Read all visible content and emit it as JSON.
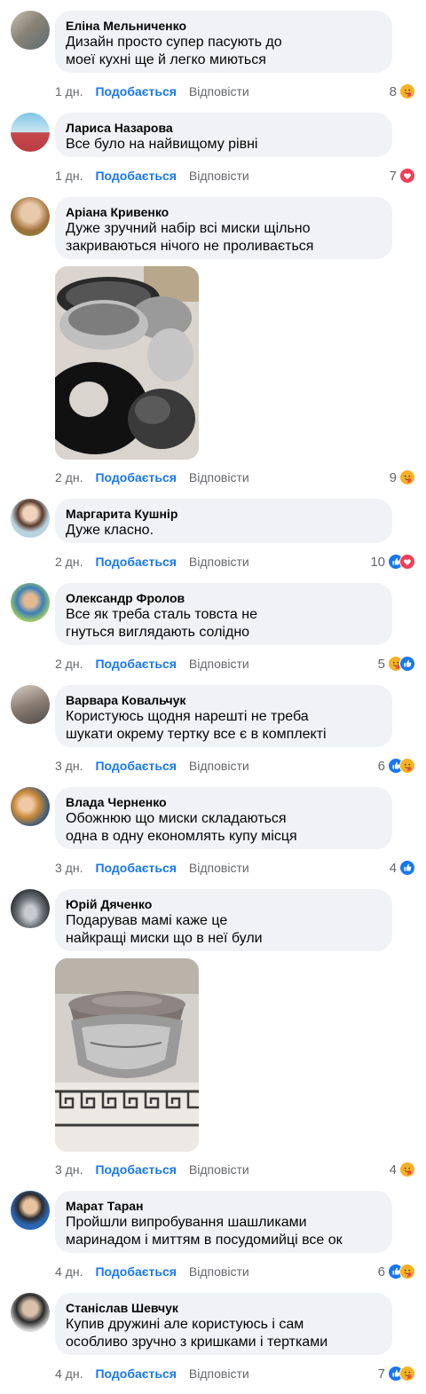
{
  "labels": {
    "like": "Подобається",
    "reply": "Відповісти"
  },
  "comments": [
    {
      "name": "Еліна Мельниченко",
      "lines": [
        "Дизайн просто супер пасують до",
        "моеї кухні ще й легко миються"
      ],
      "time": "1 дн.",
      "count": "8",
      "reactions": [
        "care-icon"
      ]
    },
    {
      "name": "Лариса Назарова",
      "lines": [
        "Все було на найвищому рівні"
      ],
      "time": "1 дн.",
      "count": "7",
      "reactions": [
        "love-icon"
      ]
    },
    {
      "name": "Аріана Кривенко",
      "lines": [
        "Дуже зручний набір всі миски щільно",
        "закриваються нічого не проливається"
      ],
      "time": "2 дн.",
      "count": "9",
      "reactions": [
        "care-icon"
      ]
    },
    {
      "name": "Маргарита Кушнір",
      "lines": [
        "Дуже класно."
      ],
      "time": "2 дн.",
      "count": "10",
      "reactions": [
        "like-icon",
        "love-icon"
      ]
    },
    {
      "name": "Олександр Фролов",
      "lines": [
        "Все як треба сталь товста не",
        "гнуться виглядають солідно"
      ],
      "time": "2 дн.",
      "count": "5",
      "reactions": [
        "care-icon",
        "like-icon"
      ]
    },
    {
      "name": "Варвара Ковальчук",
      "lines": [
        "Користуюсь щодня нарешті не треба",
        "шукати окрему тертку все є в комплекті"
      ],
      "time": "3 дн.",
      "count": "6",
      "reactions": [
        "like-icon",
        "care-icon"
      ]
    },
    {
      "name": "Влада Черненко",
      "lines": [
        "Обожнюю що миски складаються",
        "одна в одну економлять купу місця"
      ],
      "time": "3 дн.",
      "count": "4",
      "reactions": [
        "like-icon"
      ]
    },
    {
      "name": "Юрій Дяченко",
      "lines": [
        "Подарував мамі каже це",
        "найкращі миски що в неї були"
      ],
      "time": "3 дн.",
      "count": "4",
      "reactions": [
        "care-icon"
      ]
    },
    {
      "name": "Марат Таран",
      "lines": [
        "Пройшли випробування шашликами",
        "маринадом і миттям в посудомийці все ок"
      ],
      "time": "4 дн.",
      "count": "6",
      "reactions": [
        "like-icon",
        "care-icon"
      ]
    },
    {
      "name": "Станіслав Шевчук",
      "lines": [
        "Купив дружині але користуюсь і сам",
        "особливо зручно з кришками і тертками"
      ],
      "time": "4 дн.",
      "count": "7",
      "reactions": [
        "like-icon",
        "care-icon"
      ]
    }
  ],
  "colors": {
    "like_blue": "#1877f2",
    "love_red": "#f33e58",
    "care_yellow": "#f7b125",
    "bubble": "#f0f2f5",
    "meta_gray": "#65676b"
  }
}
